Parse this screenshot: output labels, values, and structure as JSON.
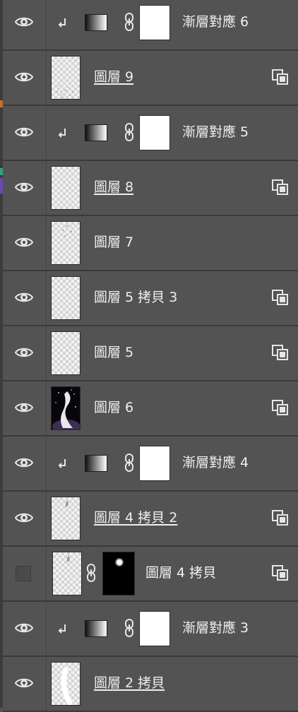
{
  "panel": {
    "layers": [
      {
        "type": "adjustment",
        "visible": true,
        "clipped": true,
        "name": "漸層對應 6",
        "icon": "gradient-map-icon",
        "mask": "white"
      },
      {
        "type": "pixel",
        "visible": true,
        "name": "圖層 9",
        "underline": true,
        "smart": true,
        "thumb": "speckle"
      },
      {
        "type": "adjustment",
        "visible": true,
        "clipped": true,
        "name": "漸層對應 5",
        "icon": "gradient-map-icon",
        "mask": "white"
      },
      {
        "type": "pixel",
        "visible": true,
        "name": "圖層 8",
        "underline": true,
        "smart": true,
        "thumb": "empty"
      },
      {
        "type": "pixel",
        "visible": true,
        "name": "圖層 7",
        "underline": false,
        "smart": false,
        "thumb": "dots"
      },
      {
        "type": "pixel",
        "visible": true,
        "name": "圖層 5 拷貝 3",
        "underline": false,
        "smart": true,
        "thumb": "empty"
      },
      {
        "type": "pixel",
        "visible": true,
        "name": "圖層 5",
        "underline": false,
        "smart": true,
        "thumb": "empty"
      },
      {
        "type": "pixel",
        "visible": true,
        "name": "圖層 6",
        "underline": false,
        "smart": true,
        "thumb": "figure"
      },
      {
        "type": "adjustment",
        "visible": true,
        "clipped": true,
        "name": "漸層對應 4",
        "icon": "gradient-map-icon",
        "mask": "white"
      },
      {
        "type": "pixel",
        "visible": true,
        "name": "圖層 4 拷貝 2",
        "underline": true,
        "smart": true,
        "thumb": "smudge"
      },
      {
        "type": "masked",
        "visible": false,
        "name": "圖層 4 拷貝",
        "underline": false,
        "smart": true,
        "thumb": "smudge",
        "mask": "black-glow"
      },
      {
        "type": "adjustment",
        "visible": true,
        "clipped": true,
        "name": "漸層對應 3",
        "icon": "gradient-map-icon",
        "mask": "white"
      },
      {
        "type": "pixel",
        "visible": true,
        "name": "圖層 2 拷貝",
        "underline": true,
        "smart": false,
        "thumb": "crescent"
      }
    ]
  },
  "colors": {
    "panel_bg": "#535353",
    "separator": "#3a3a3a",
    "text": "#ececec"
  }
}
